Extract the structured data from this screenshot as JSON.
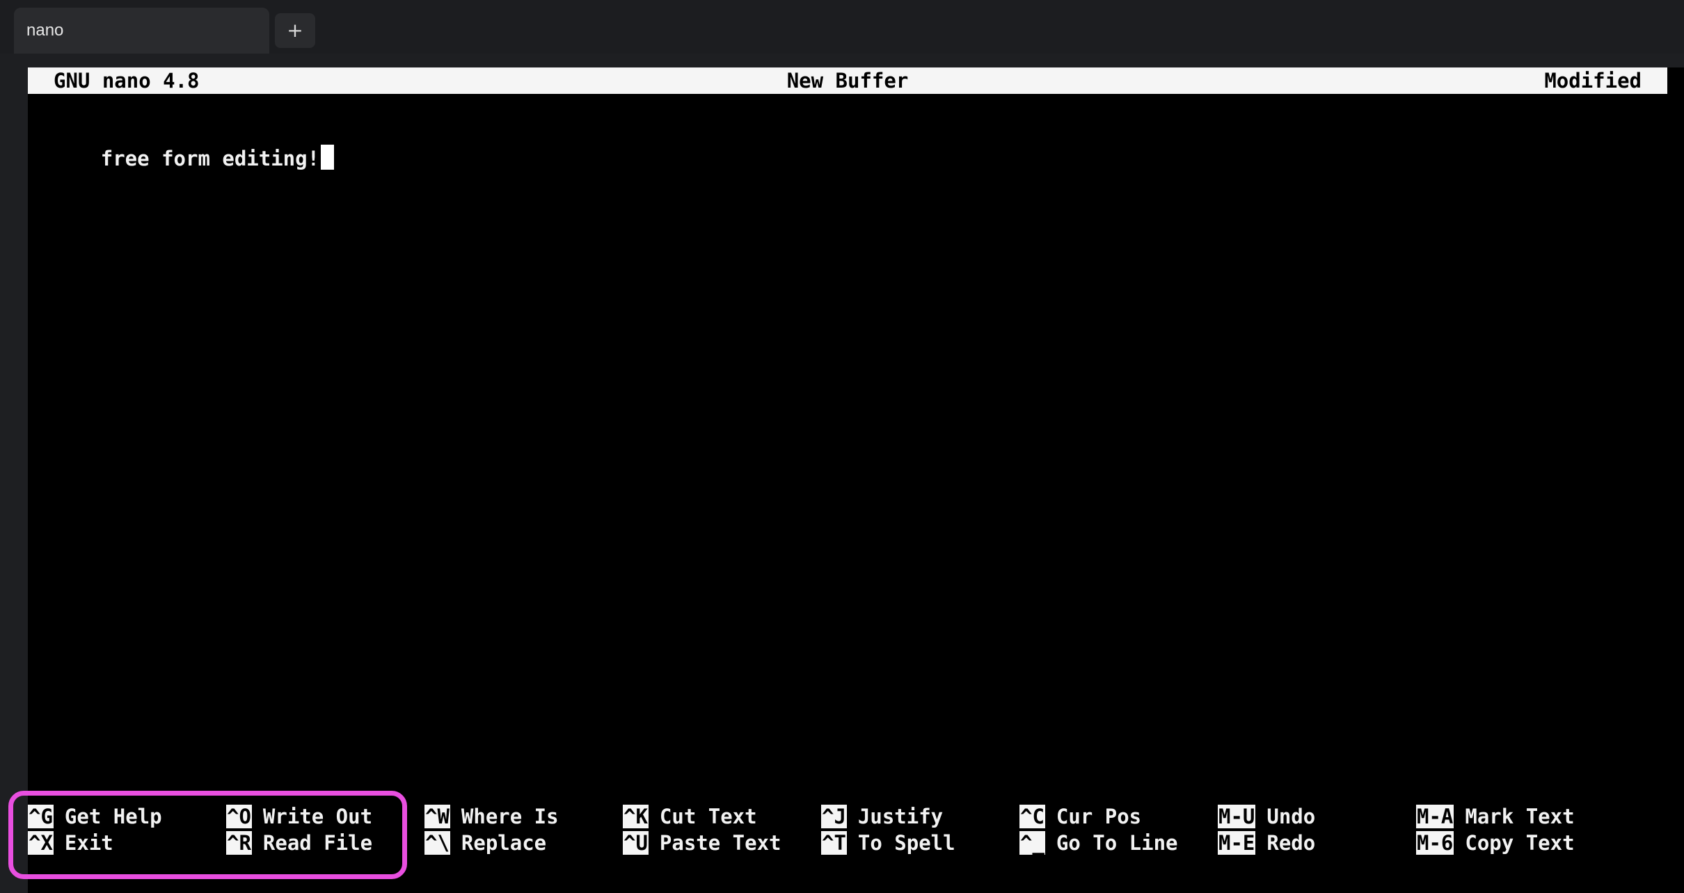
{
  "tabs": [
    {
      "label": "nano"
    }
  ],
  "new_tab_label": "+",
  "nano": {
    "version": "GNU nano 4.8",
    "buffer_name": "New Buffer",
    "status": "Modified",
    "content": "free form editing!",
    "shortcuts": [
      {
        "key": "^G",
        "label": "Get Help"
      },
      {
        "key": "^O",
        "label": "Write Out"
      },
      {
        "key": "^W",
        "label": "Where Is"
      },
      {
        "key": "^K",
        "label": "Cut Text"
      },
      {
        "key": "^J",
        "label": "Justify"
      },
      {
        "key": "^C",
        "label": "Cur Pos"
      },
      {
        "key": "M-U",
        "label": "Undo"
      },
      {
        "key": "M-A",
        "label": "Mark Text"
      },
      {
        "key": "^X",
        "label": "Exit"
      },
      {
        "key": "^R",
        "label": "Read File"
      },
      {
        "key": "^\\",
        "label": "Replace"
      },
      {
        "key": "^U",
        "label": "Paste Text"
      },
      {
        "key": "^T",
        "label": "To Spell"
      },
      {
        "key": "^_",
        "label": "Go To Line"
      },
      {
        "key": "M-E",
        "label": "Redo"
      },
      {
        "key": "M-6",
        "label": "Copy Text"
      }
    ]
  },
  "colors": {
    "highlight": "#e94fe0"
  }
}
